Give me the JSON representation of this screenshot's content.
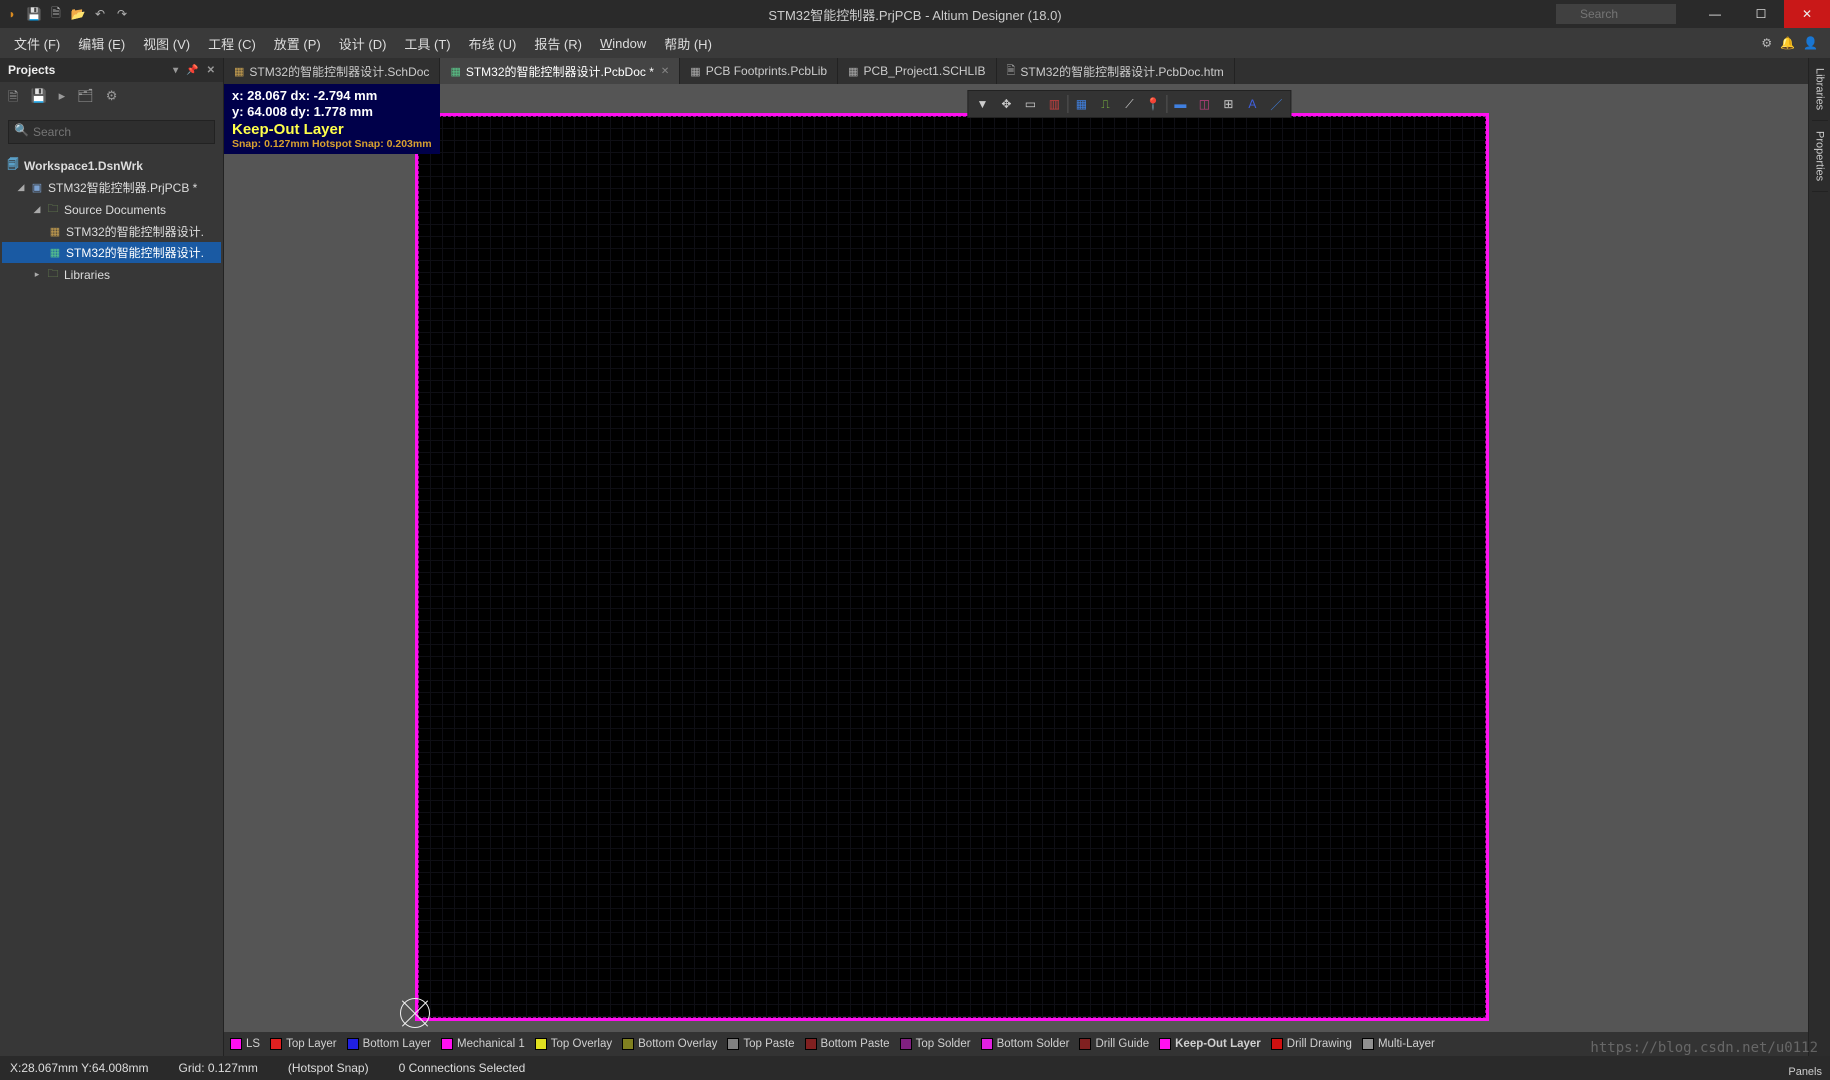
{
  "titlebar": {
    "title": "STM32智能控制器.PrjPCB - Altium Designer (18.0)",
    "search_placeholder": "Search"
  },
  "menu": {
    "items": [
      "文件 (F)",
      "编辑 (E)",
      "视图 (V)",
      "工程 (C)",
      "放置 (P)",
      "设计 (D)",
      "工具 (T)",
      "布线 (U)",
      "报告 (R)",
      "Window",
      "帮助 (H)"
    ]
  },
  "projects": {
    "title": "Projects",
    "search_placeholder": "Search",
    "tree": {
      "workspace": "Workspace1.DsnWrk",
      "project": "STM32智能控制器.PrjPCB *",
      "source_folder": "Source Documents",
      "doc1": "STM32的智能控制器设计.",
      "doc2": "STM32的智能控制器设计.",
      "libs": "Libraries"
    }
  },
  "tabs": [
    {
      "label": "STM32的智能控制器设计.SchDoc",
      "icon": "gold",
      "active": false
    },
    {
      "label": "STM32的智能控制器设计.PcbDoc *",
      "icon": "green",
      "active": true
    },
    {
      "label": "PCB Footprints.PcbLib",
      "icon": "grey",
      "active": false
    },
    {
      "label": "PCB_Project1.SCHLIB",
      "icon": "grey",
      "active": false
    },
    {
      "label": "STM32的智能控制器设计.PcbDoc.htm",
      "icon": "grey",
      "active": false
    }
  ],
  "hud": {
    "line1": "x: 28.067   dx: -2.794 mm",
    "line2": "y: 64.008   dy:  1.778 mm",
    "layer": "Keep-Out Layer",
    "snap": "Snap: 0.127mm Hotspot Snap: 0.203mm"
  },
  "edge_tabs": [
    "Libraries",
    "Properties"
  ],
  "layers": [
    {
      "name": "LS",
      "color": "#ff10f0"
    },
    {
      "name": "Top Layer",
      "color": "#e02020"
    },
    {
      "name": "Bottom Layer",
      "color": "#2020e0"
    },
    {
      "name": "Mechanical 1",
      "color": "#ff10f0"
    },
    {
      "name": "Top Overlay",
      "color": "#e0e020"
    },
    {
      "name": "Bottom Overlay",
      "color": "#808020"
    },
    {
      "name": "Top Paste",
      "color": "#808080"
    },
    {
      "name": "Bottom Paste",
      "color": "#802020"
    },
    {
      "name": "Top Solder",
      "color": "#802080"
    },
    {
      "name": "Bottom Solder",
      "color": "#e020e0"
    },
    {
      "name": "Drill Guide",
      "color": "#802020"
    },
    {
      "name": "Keep-Out Layer",
      "color": "#ff10f0",
      "active": true
    },
    {
      "name": "Drill Drawing",
      "color": "#d01010"
    },
    {
      "name": "Multi-Layer",
      "color": "#909090"
    }
  ],
  "statusbar": {
    "coords": "X:28.067mm Y:64.008mm",
    "grid": "Grid: 0.127mm",
    "snap": "(Hotspot Snap)",
    "sel": "0 Connections Selected",
    "panels": "Panels"
  },
  "watermark": "https://blog.csdn.net/u0112"
}
